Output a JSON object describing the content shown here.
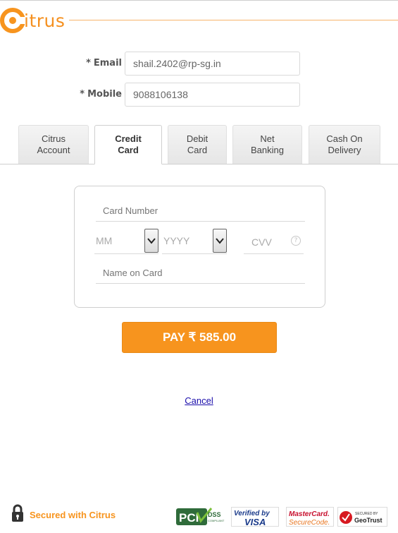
{
  "brand": {
    "logo_letter": "C",
    "logo_text": "itrus",
    "accent_color": "#f7941e"
  },
  "contact": {
    "email_label": "Email",
    "email_value": "shail.2402@rp-sg.in",
    "mobile_label": "Mobile",
    "mobile_value": "9088106138",
    "required_marker": "*"
  },
  "tabs": [
    {
      "line1": "Citrus",
      "line2": "Account",
      "active": false
    },
    {
      "line1": "Credit",
      "line2": "Card",
      "active": true
    },
    {
      "line1": "Debit",
      "line2": "Card",
      "active": false
    },
    {
      "line1": "Net",
      "line2": "Banking",
      "active": false
    },
    {
      "line1": "Cash On",
      "line2": "Delivery",
      "active": false
    }
  ],
  "card_form": {
    "card_number_placeholder": "Card Number",
    "month_placeholder": "MM",
    "year_placeholder": "YYYY",
    "cvv_placeholder": "CVV",
    "cvv_help_symbol": "?",
    "name_placeholder": "Name on Card"
  },
  "pay_button": {
    "label": "PAY ₹ 585.00"
  },
  "cancel_link": "Cancel",
  "footer": {
    "secured_text": "Secured with Citrus",
    "badges": {
      "pci_main": "PCI",
      "pci_dss": "DSS",
      "pci_sub": "COMPLIANT",
      "visa_top": "Verified by",
      "visa_bottom": "VISA",
      "mc_top": "MasterCard.",
      "mc_bottom": "SecureCode.",
      "geo_top": "SECURED BY",
      "geo_bottom": "GeoTrust"
    }
  }
}
